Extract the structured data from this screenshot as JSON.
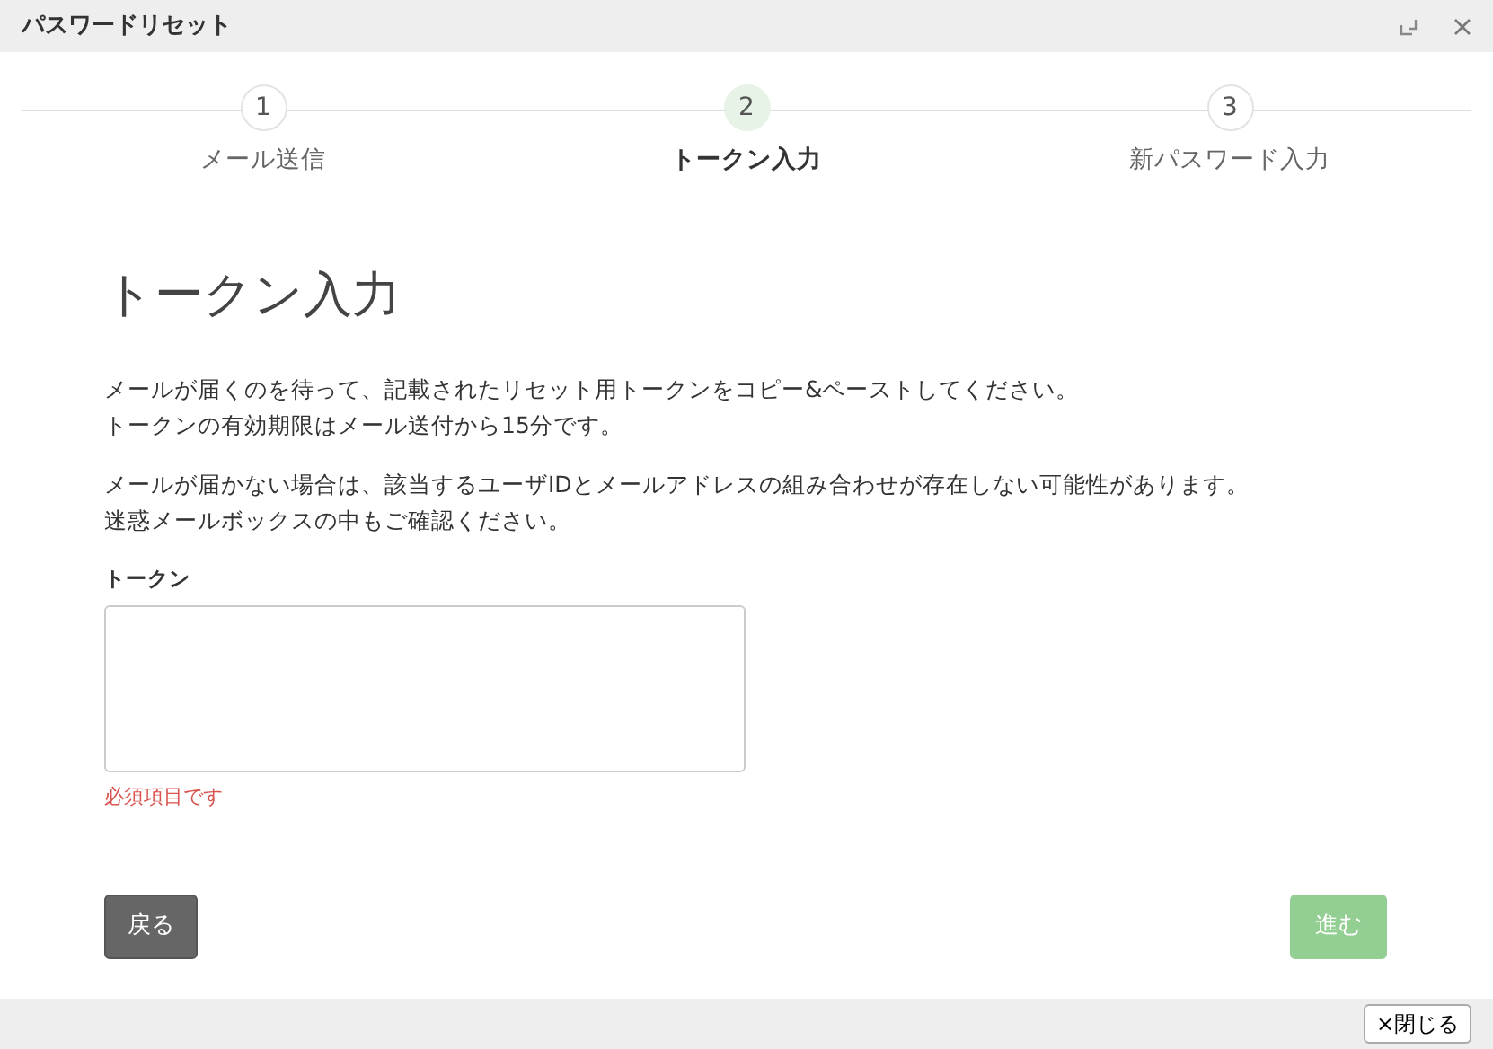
{
  "window": {
    "title": "パスワードリセット"
  },
  "steps": [
    {
      "number": "1",
      "label": "メール送信",
      "selected": false
    },
    {
      "number": "2",
      "label": "トークン入力",
      "selected": true
    },
    {
      "number": "3",
      "label": "新パスワード入力",
      "selected": false
    }
  ],
  "heading": "トークン入力",
  "paragraphs": [
    [
      "メールが届くのを待って、記載されたリセット用トークンをコピー&ペーストしてください。",
      "トークンの有効期限はメール送付から15分です。"
    ],
    [
      "メールが届かない場合は、該当するユーザIDとメールアドレスの組み合わせが存在しない可能性があります。",
      "迷惑メールボックスの中もご確認ください。"
    ]
  ],
  "token_field": {
    "label": "トークン",
    "error": "必須項目です"
  },
  "back_button": {
    "label": "戻る"
  },
  "next_button": {
    "label": "進む",
    "disabled": true
  },
  "close_button": {
    "label": "×閉じる"
  }
}
